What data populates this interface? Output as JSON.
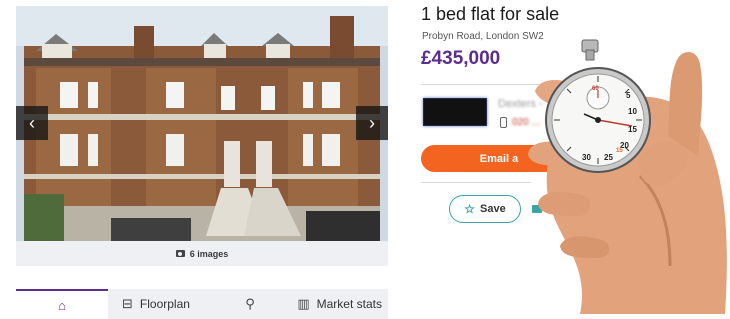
{
  "gallery": {
    "image_count_label": "6 images",
    "prev_symbol": "‹",
    "next_symbol": "›"
  },
  "tabs": {
    "floorplan": "Floorplan",
    "market_stats": "Market stats"
  },
  "listing": {
    "title": "1 bed flat for sale",
    "address": "Probyn Road, London SW2",
    "price": "£435,000"
  },
  "agent": {
    "name_blurred": "Dexters - ...",
    "phone_blurred": "020 ..."
  },
  "actions": {
    "email_label": "Email a",
    "save_label": "Save"
  },
  "stopwatch": {
    "dial_labels": [
      "5",
      "10",
      "15",
      "20",
      "25",
      "30"
    ],
    "minute_labels": [
      "60",
      "15"
    ]
  },
  "colors": {
    "brand_purple": "#5b2d8e",
    "email_orange": "#f2641f",
    "save_teal": "#3aa3a3"
  }
}
